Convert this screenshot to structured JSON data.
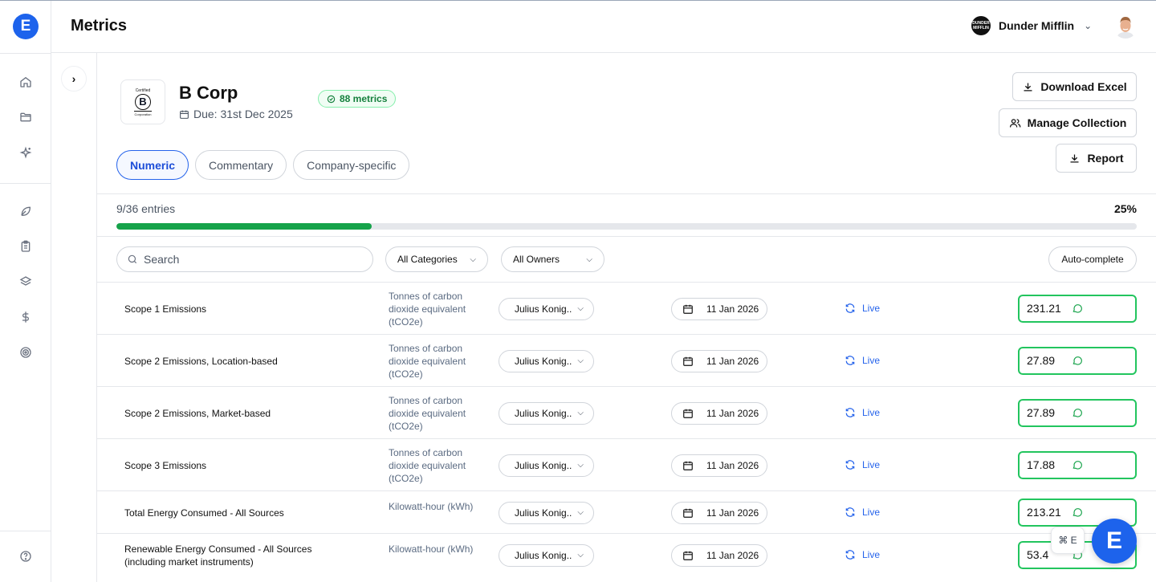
{
  "app": {
    "logo_letter": "E"
  },
  "header": {
    "title": "Metrics",
    "org_name": "Dunder Mifflin",
    "org_logo_text": "DUNDER MIFFLIN"
  },
  "collection": {
    "name": "B Corp",
    "due": "Due: 31st Dec 2025",
    "metrics_badge": "88 metrics",
    "logo_top": "Certified",
    "logo_letter": "B",
    "logo_bottom": "Corporation"
  },
  "actions": {
    "download_excel": "Download Excel",
    "manage_collection": "Manage Collection",
    "report": "Report"
  },
  "tabs": [
    {
      "label": "Numeric",
      "active": true
    },
    {
      "label": "Commentary",
      "active": false
    },
    {
      "label": "Company-specific",
      "active": false
    }
  ],
  "progress": {
    "entries_label": "9/36 entries",
    "percent_label": "25%",
    "fraction": 0.25
  },
  "filters": {
    "search_placeholder": "Search",
    "categories": "All Categories",
    "owners": "All Owners",
    "auto_complete": "Auto-complete"
  },
  "metrics": [
    {
      "name": "Scope 1 Emissions",
      "unit": "Tonnes of carbon dioxide equivalent (tCO2e)",
      "owner": "Julius Konig..",
      "date": "11 Jan 2026",
      "status": "Live",
      "value": "231.21"
    },
    {
      "name": "Scope 2 Emissions, Location-based",
      "unit": "Tonnes of carbon dioxide equivalent (tCO2e)",
      "owner": "Julius Konig..",
      "date": "11 Jan 2026",
      "status": "Live",
      "value": "27.89"
    },
    {
      "name": "Scope 2 Emissions, Market-based",
      "unit": "Tonnes of carbon dioxide equivalent (tCO2e)",
      "owner": "Julius Konig..",
      "date": "11 Jan 2026",
      "status": "Live",
      "value": "27.89"
    },
    {
      "name": "Scope 3 Emissions",
      "unit": "Tonnes of carbon dioxide equivalent (tCO2e)",
      "owner": "Julius Konig..",
      "date": "11 Jan 2026",
      "status": "Live",
      "value": "17.88"
    },
    {
      "name": "Total Energy Consumed - All Sources",
      "unit": "Kilowatt-hour (kWh)",
      "owner": "Julius Konig..",
      "date": "11 Jan 2026",
      "status": "Live",
      "value": "213.21"
    },
    {
      "name": "Renewable Energy Consumed - All Sources (including market instruments)",
      "unit": "Kilowatt-hour (kWh)",
      "owner": "Julius Konig..",
      "date": "11 Jan 2026",
      "status": "Live",
      "value": "53.4"
    }
  ],
  "floating": {
    "shortcut": "⌘ E",
    "assistant_letter": "E"
  },
  "colors": {
    "brand": "#1d63ec",
    "success": "#22c55e",
    "link": "#2563eb"
  }
}
